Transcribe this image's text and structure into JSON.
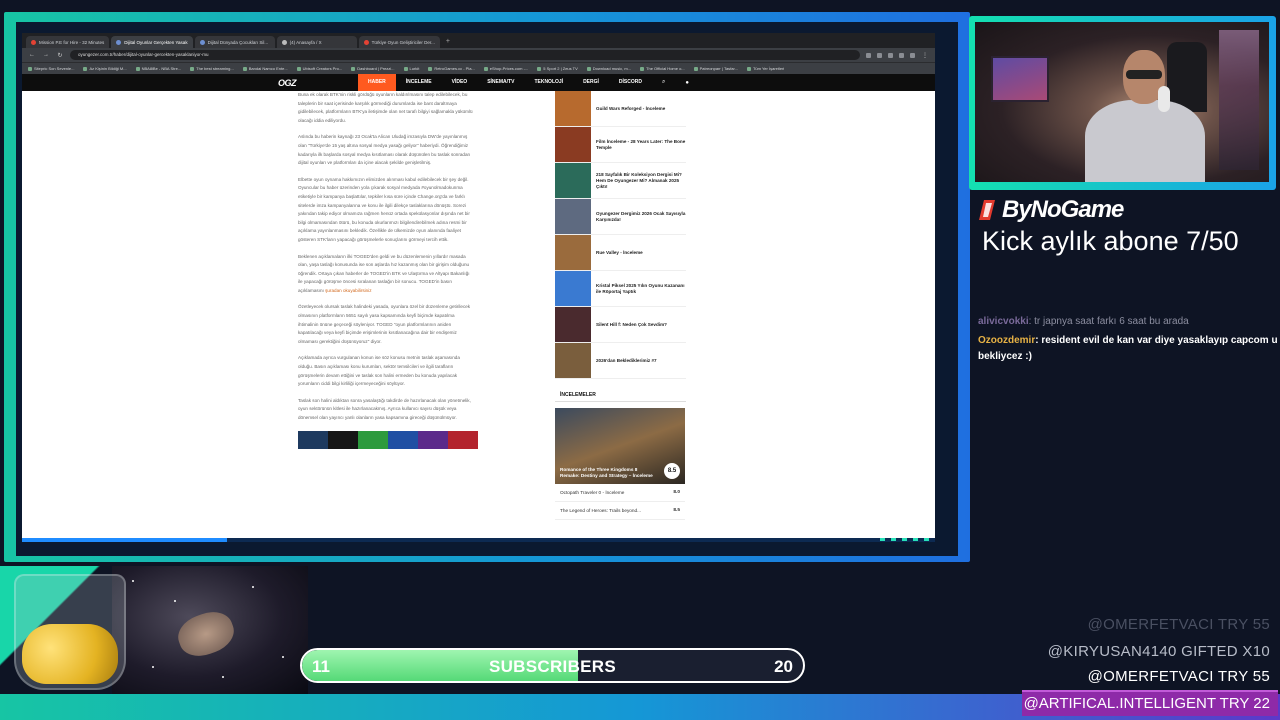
{
  "browser": {
    "tabs": [
      {
        "label": "Mission P.E for Hire - 32 Minutes"
      },
      {
        "label": "Dijital Oyunlar Gerçekten Yasak",
        "active": true
      },
      {
        "label": "Dijital Dünyada Çocukları Sil..."
      },
      {
        "label": "(4) Anasayfa / X"
      },
      {
        "label": "Türkiye Oyun Geliştiriciler Der..."
      }
    ],
    "url": "oyungezer.com.tr/haber/dijital-oyunlar-gercekten-yasaklaniyor-mu",
    "bookmarks": [
      "Sitepric Son Sevenle...",
      "Az Kişinin Bildiği M...",
      "NBA8iBe - NBA Stre...",
      "The best streaming...",
      "Bandai Namco Ente...",
      "Ubisoft Creators Pro...",
      "Dashboard | Prezzi...",
      "Lurkit",
      "RetroGames.cc - Pla...",
      "eShop-Prices.com -...",
      "5 Sport 2 | Zeus TV",
      "Download music, m...",
      "The Official Home o...",
      "Patreonparr | Tasfar...",
      "Tüm Yer İşaretleri"
    ]
  },
  "site": {
    "logo": "OGZ",
    "nav": [
      "HABER",
      "İNCELEME",
      "VİDEO",
      "SİNEMA/TV",
      "TEKNOLOJİ",
      "DERGİ",
      "DİSCORD"
    ],
    "active_nav": "HABER"
  },
  "article": {
    "paragraphs": [
      "Buna ek olarak BTK'nin riskli gördüğü oyunların kaldırılmasını talep edilebilecek, bu taleplerin bir saat içerisinde karşılık görmediği durumlarda ise bant daraltmaya gidilebilecek, platformların BTK'ya iletişimde olan net tarafı bilgiyi sağlamakla yükümlü olacağı iddia ediliyordu.",
      "Aslında bu haberin kaynağı 23 Ocak'ta Alican Uludağ imzasıyla DW'de yayınlanmış olan \"Türkiye'de 15 yaş altına sosyal medya yasağı geliyor\" haberiydi. Öğrendiğimiz kadarıyla ilk başlarda sosyal medya kısıtlaması olarak düşünülen bu taslak sonradan dijital oyunları ve platformları da içine alacak şekilde genişletilmiş.",
      "Elbette oyun oynama hakkımızın elimizden alınması kabul edilebilecek bir şey değil. Oyuncular bu haber üzerinden yola çıkarak sosyal medyada #oyunolmadokunma etiketiyle bir kampanya başlattılar, tepkiler kısa süre içinde Change.org'da ve farklı sitelerde imza kampanyalarına ve konu ile ilgili dilekçe taslaklarına dönüştü. Sorezi yakından takip ediyor olmamıza rağmen henüz ortada spekülasyonlar dışında net bir bilgi olmamasından ötürü, bu konuda okurlarımızı bilgilendirebilmek adına resmi bir açıklama yayınlanmasını bekledik. Özellikle de ülkemizde oyun alanında faaliyet gösteren STK'ların yapacağı görüşmelerle sonuçlarını görmeyi tercih ettik.",
      "Beklenen açıklamaların ilki TOGED'den geldi ve bu düzenlemenin yıllardır masada olan, yaşa taslağı konusunda ise son aşlarda hız kazanmış olan bir girişim olduğunu öğrendik. Ortaya çıkan haberler de TOGED'in BTK ve Ulaştırma ve Altyapı Bakanlığı ile yapacağı görüşme öncesi sıralanan taslağın bir sonucu. TOGED'in basın açıklamasını",
      "Özetleyecek olursak taslak halindeki yasada, oyunlara özel bir düzenleme getirilecek olmasının platformların 5651 sayılı yasa kapsamında keyfi biçimde kapatılma ihtimalinin önüne geçeceği söyleniyor. TOGED \"oyun platformlarının aniden kapatılacağı veya keyfi biçimde erişimlerinin kısıtlanacağına dair bir endişemiz olmaması gerektiğini düşünüyoruz\" diyor.",
      "Açıklamada ayrıca vurgulanan konun ise söz konusu metnin taslak aşamasında olduğu. Basın açıklaması konu kurumları, sektör temsilcileri ve ilgili tarafların görüşmelerin devam ettiğini ve taslak son halini ermeden bu konuda yapılacak yorumların ciddi bilgi kirliliği içermeyeceğini söylüyor.",
      "Taslak son halini aldıktan sonra yasalaştığı takdirde de hazırlanacak olan yönetmelik, oyun sektörünün kitlesi ile hazırlanacakmış. Ayrıca kullanıcı sayısı düşük veya dönemsel olan yayıncı yanlı olanların yasa kapsamına gireceği düşünülmüyor."
    ],
    "link_text": "şuradan okuyabilirsiniz",
    "strip_colors": [
      "#1e3a5f",
      "#161616",
      "#2d9a3e",
      "#1f4fa3",
      "#5b2a8a",
      "#b3242e"
    ]
  },
  "sidebar": {
    "items": [
      {
        "title": "Guild Wars Reforged - İnceleme",
        "color": "#b76a2e"
      },
      {
        "title": "Film İnceleme - 28 Years Later: The Bone Temple",
        "color": "#8a3b22"
      },
      {
        "title": "218 Sayfalık Bir Koleksiyon Dergisi Mi? Hem De Oyungezer Mi? Almanak 2025 Çıktı!",
        "color": "#2b6b5a"
      },
      {
        "title": "Oyungezer Dergimiz 2026 Ocak Sayısıyla Karşınızda!",
        "color": "#5e6a80"
      },
      {
        "title": "Rue Valley - İnceleme",
        "color": "#9a6b3d"
      },
      {
        "title": "Kristal Piksel 2025 Yılın Oyunu Kazananı ile Röportaj Yaptık",
        "color": "#3a7ad1"
      },
      {
        "title": "Silent Hill f: Neden Çok Sevdim?",
        "color": "#4a2a2e"
      },
      {
        "title": "2026'dan Beklediklerimiz #7",
        "color": "#7a5e3d"
      }
    ],
    "reviews_heading": "İNCELEMELER",
    "feature": {
      "title": "Romance of the Three Kingdoms 8 Remake: Destiny and Strategy – İnceleme",
      "score": "8.5"
    },
    "reviews": [
      {
        "title": "Octopath Traveler 0 - İnceleme",
        "score": "8.0"
      },
      {
        "title": "The Legend of Heroes: Trails beyond...",
        "score": "8.5"
      }
    ]
  },
  "overlay": {
    "brand": "ByNoGame",
    "sub_goal": "Kick aylık abone 7/50",
    "chat": [
      {
        "user": "alivicvokki",
        "text": ": tr japnya saat farkı 6 saat bu arada",
        "faded": true
      },
      {
        "user": "Ozoozdemir",
        "text": ": resident evil de kan var diye yasaklayıp capcom u",
        "faded": false
      },
      {
        "user": "",
        "text": "bekliycez :)",
        "faded": false
      }
    ],
    "events": [
      {
        "text": "@OMERFETVACI  TRY 55"
      },
      {
        "text": "@KIRYUSAN4140  GIFTED X10"
      },
      {
        "text": "@OMERFETVACI  TRY 55"
      },
      {
        "text": "@ARTIFICAL.INTELLIGENT  TRY 22"
      }
    ],
    "subscribers": {
      "start": "11",
      "label": "SUBSCRIBERS",
      "end": "20",
      "progress": 0.55
    },
    "accent": "#17c5a4",
    "highlight": "#8e2aa8"
  }
}
